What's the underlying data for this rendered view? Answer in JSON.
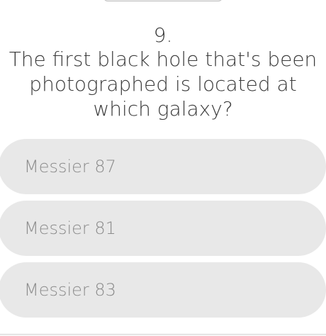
{
  "question": {
    "number": "9.",
    "text": "The first black hole that's been photographed is located at which galaxy?"
  },
  "options": [
    {
      "label": "Messier 87"
    },
    {
      "label": "Messier 81"
    },
    {
      "label": "Messier 83"
    }
  ],
  "colors": {
    "option_background": "#e8e8e8",
    "option_text": "#8c8c8c",
    "question_text": "#3a3a3a"
  }
}
